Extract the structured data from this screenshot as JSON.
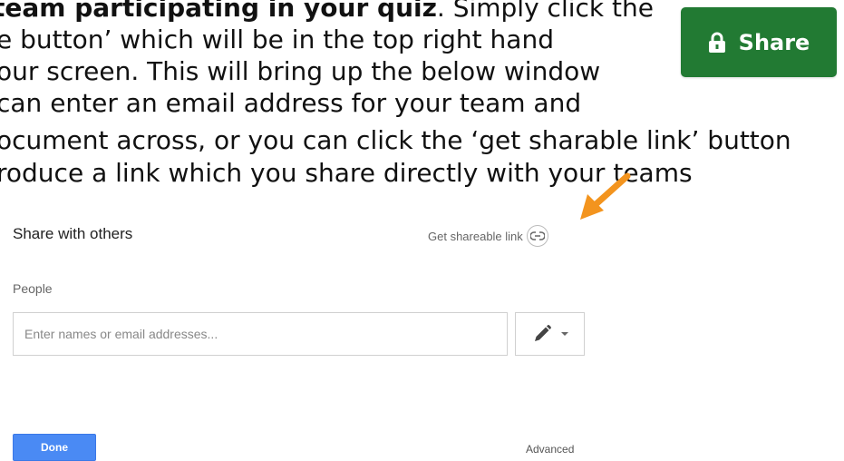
{
  "instructions": {
    "line1_bold": "team participating in your quiz",
    "line1_rest": ". Simply click the",
    "line2": "e button’ which will be in the top right hand",
    "line3": "our screen. This will bring up the below window",
    "line4": "can enter an email address for your team and",
    "line5": "ocument across, or you can click the ‘get sharable link’ button",
    "line6": "roduce a link which you share directly with your teams"
  },
  "share_button": {
    "label": "Share",
    "icon": "lock-icon",
    "color": "#227a33"
  },
  "annotation_arrow": {
    "icon": "arrow-icon",
    "color": "#f3941e"
  },
  "dialog": {
    "title": "Share with others",
    "shareable_link_label": "Get shareable link",
    "people_label": "People",
    "people_placeholder": "Enter names or email addresses...",
    "permission_icon": "pencil-icon",
    "done_label": "Done",
    "advanced_label": "Advanced",
    "accent_color": "#4a8af4"
  }
}
